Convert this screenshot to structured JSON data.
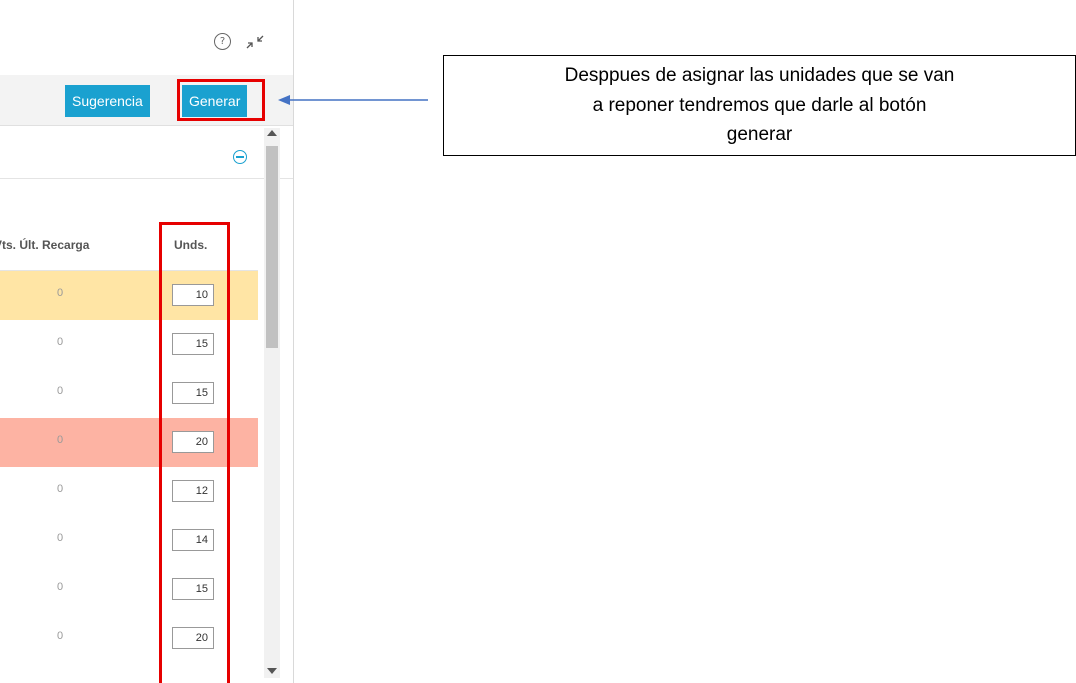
{
  "header": {
    "help_icon": "?",
    "collapse_icon": "collapse-arrows"
  },
  "toolbar": {
    "sugerencia_label": "Sugerencia",
    "generar_label": "Generar"
  },
  "table": {
    "columns": {
      "vts": "Vts. Últ. Recarga",
      "unds": "Unds."
    },
    "rows": [
      {
        "vts": "0",
        "unds": "10",
        "highlight": "yellow"
      },
      {
        "vts": "0",
        "unds": "15",
        "highlight": "none"
      },
      {
        "vts": "0",
        "unds": "15",
        "highlight": "none"
      },
      {
        "vts": "0",
        "unds": "20",
        "highlight": "salmon"
      },
      {
        "vts": "0",
        "unds": "12",
        "highlight": "none"
      },
      {
        "vts": "0",
        "unds": "14",
        "highlight": "none"
      },
      {
        "vts": "0",
        "unds": "15",
        "highlight": "none"
      },
      {
        "vts": "0",
        "unds": "20",
        "highlight": "none"
      }
    ]
  },
  "annotation": {
    "text": "Desppues de asignar las unidades que se van a reponer tendremos que darle al botón generar",
    "highlight_color": "#e60000",
    "arrow_color": "#4472c4"
  },
  "colors": {
    "accent": "#1aa1d0",
    "yellow_row": "#ffe5a5",
    "salmon_row": "#fdb3a3"
  }
}
